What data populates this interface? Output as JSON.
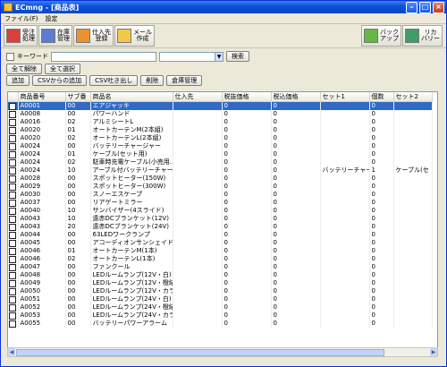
{
  "window": {
    "title": "ECmng - [商品表]"
  },
  "menu": {
    "items": [
      "ファイル(F)",
      "設定"
    ]
  },
  "toolbar": {
    "left": [
      {
        "label": "受注\n処理",
        "icon": "order-icon"
      },
      {
        "label": "在庫\n管理",
        "icon": "stock-icon"
      },
      {
        "label": "仕入先\n登録",
        "icon": "supplier-icon"
      },
      {
        "label": "メール\n作成",
        "icon": "mail-icon"
      }
    ],
    "right": [
      {
        "label": "バック\nアップ",
        "icon": "backup-icon"
      },
      {
        "label": "リカ\nバリー",
        "icon": "recovery-icon"
      }
    ]
  },
  "filter": {
    "keyword_label": "キーワード",
    "search_label": "検索"
  },
  "buttons": {
    "deselect_all": "全て解除",
    "select_all": "全て選択",
    "add": "追加",
    "csv_add": "CSVからの追加",
    "csv_export": "CSV吐き出し",
    "delete": "削除",
    "warehouse": "倉庫管理"
  },
  "table": {
    "columns": [
      "商品番号",
      "サブ番",
      "商品名",
      "仕入先",
      "税抜価格",
      "税込価格",
      "セット1",
      "個数",
      "セット2"
    ],
    "rows": [
      [
        "A0001",
        "00",
        "エアジャッキ",
        "",
        "0",
        "0",
        "",
        "0",
        ""
      ],
      [
        "A0008",
        "00",
        "パワーハンド",
        "",
        "0",
        "0",
        "",
        "0",
        ""
      ],
      [
        "A0016",
        "02",
        "アルミシートL",
        "",
        "0",
        "0",
        "",
        "0",
        ""
      ],
      [
        "A0020",
        "01",
        "オートカーテンM(2本組)",
        "",
        "0",
        "0",
        "",
        "0",
        ""
      ],
      [
        "A0020",
        "02",
        "オートカーテンL(2本組)",
        "",
        "0",
        "0",
        "",
        "0",
        ""
      ],
      [
        "A0024",
        "00",
        "バッテリーチャージャー",
        "",
        "0",
        "0",
        "",
        "0",
        ""
      ],
      [
        "A0024",
        "01",
        "ケーブル(セット用)",
        "",
        "0",
        "0",
        "",
        "0",
        ""
      ],
      [
        "A0024",
        "02",
        "駐車時充電ケーブル(小売用...",
        "",
        "0",
        "0",
        "",
        "0",
        ""
      ],
      [
        "A0024",
        "10",
        "アーブル付バッテリーチャー...",
        "",
        "0",
        "0",
        "バッテリーチャー...",
        "1",
        "ケーブル(セ"
      ],
      [
        "A0028",
        "00",
        "スポットヒーター(150W)",
        "",
        "0",
        "0",
        "",
        "0",
        ""
      ],
      [
        "A0029",
        "00",
        "スポットヒーター(300W)",
        "",
        "0",
        "0",
        "",
        "0",
        ""
      ],
      [
        "A0030",
        "00",
        "スノーエスケープ",
        "",
        "0",
        "0",
        "",
        "0",
        ""
      ],
      [
        "A0037",
        "00",
        "リアゲートミラー",
        "",
        "0",
        "0",
        "",
        "0",
        ""
      ],
      [
        "A0040",
        "10",
        "サンバイザー(4スライド)",
        "",
        "0",
        "0",
        "",
        "0",
        ""
      ],
      [
        "A0043",
        "10",
        "遠赤DCブランケット(12V)",
        "",
        "0",
        "0",
        "",
        "0",
        ""
      ],
      [
        "A0043",
        "20",
        "遠赤DCブランケット(24V)",
        "",
        "0",
        "0",
        "",
        "0",
        ""
      ],
      [
        "A0044",
        "00",
        "63LEDワークランプ",
        "",
        "0",
        "0",
        "",
        "0",
        ""
      ],
      [
        "A0045",
        "00",
        "アコーディオンサンシェイド",
        "",
        "0",
        "0",
        "",
        "0",
        ""
      ],
      [
        "A0046",
        "01",
        "オートカーテンM(1本)",
        "",
        "0",
        "0",
        "",
        "0",
        ""
      ],
      [
        "A0046",
        "02",
        "オートカーテンL(1本)",
        "",
        "0",
        "0",
        "",
        "0",
        ""
      ],
      [
        "A0047",
        "00",
        "ファンクール",
        "",
        "0",
        "0",
        "",
        "0",
        ""
      ],
      [
        "A0048",
        "00",
        "LEDルームランプ(12V・白)",
        "",
        "0",
        "0",
        "",
        "0",
        ""
      ],
      [
        "A0049",
        "00",
        "LEDルームランプ(12V・橙結)",
        "",
        "0",
        "0",
        "",
        "0",
        ""
      ],
      [
        "A0050",
        "00",
        "LEDルームランプ(12V・カラ...",
        "",
        "0",
        "0",
        "",
        "0",
        ""
      ],
      [
        "A0051",
        "00",
        "LEDルームランプ(24V・白)",
        "",
        "0",
        "0",
        "",
        "0",
        ""
      ],
      [
        "A0052",
        "00",
        "LEDルームランプ(24V・橙結)",
        "",
        "0",
        "0",
        "",
        "0",
        ""
      ],
      [
        "A0053",
        "00",
        "LEDルームランプ(24V・カラ...",
        "",
        "0",
        "0",
        "",
        "0",
        ""
      ],
      [
        "A0055",
        "00",
        "バッテリーパワーアラーム",
        "",
        "0",
        "0",
        "",
        "0",
        ""
      ]
    ]
  },
  "colors": {
    "selection": "#316ac5",
    "titlebar": "#0a4fd6"
  }
}
